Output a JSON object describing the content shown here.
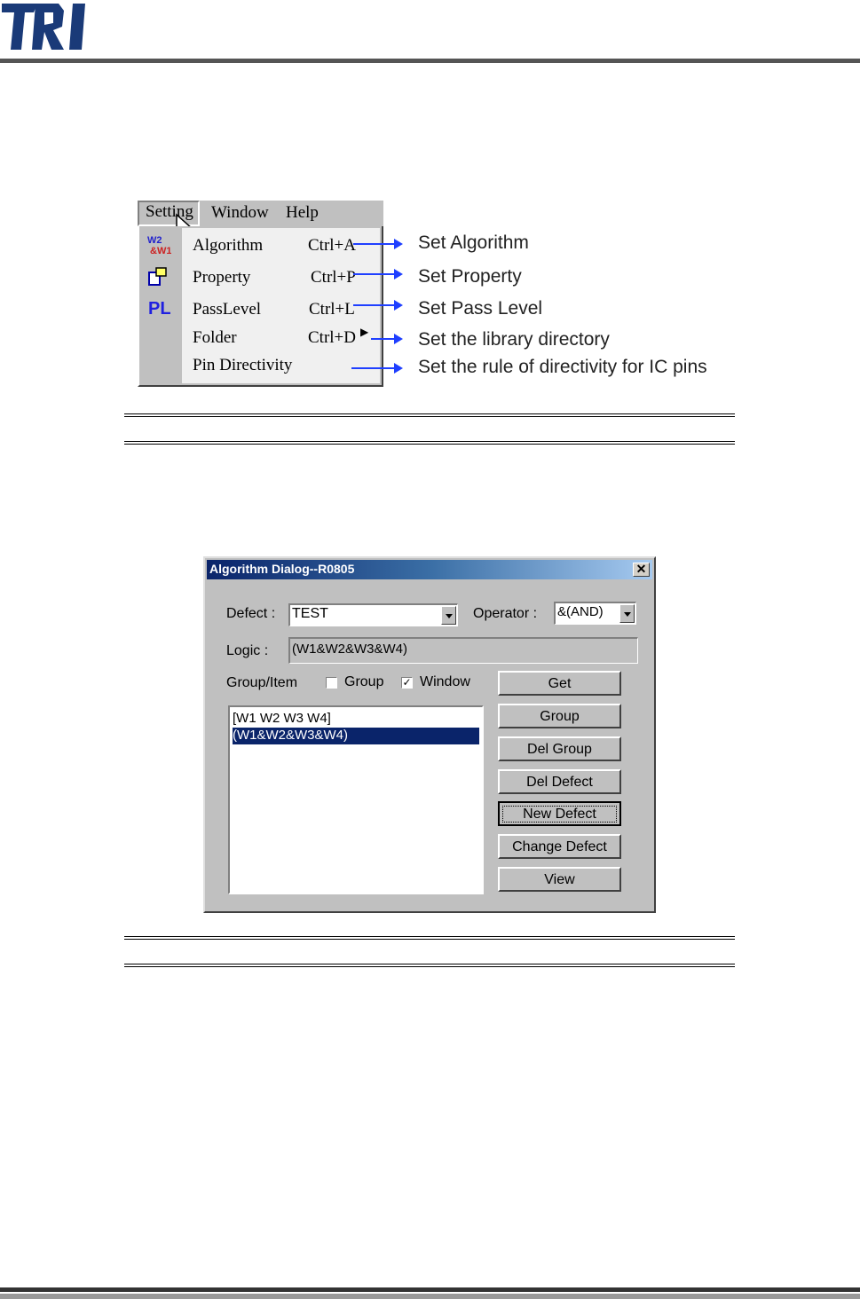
{
  "brand": {
    "logo_text": "TRI",
    "color": "#1a3a78"
  },
  "menu": {
    "bar": [
      {
        "label": "Setting",
        "name": "menu-setting"
      },
      {
        "label": "Window",
        "name": "menu-window"
      },
      {
        "label": "Help",
        "name": "menu-help"
      }
    ],
    "items": [
      {
        "label": "Algorithm",
        "shortcut": "Ctrl+A",
        "icon": "algorithm-icon",
        "annotation": "Set Algorithm"
      },
      {
        "label": "Property",
        "shortcut": "Ctrl+P",
        "icon": "property-icon",
        "annotation": "Set Property"
      },
      {
        "label": "PassLevel",
        "shortcut": "Ctrl+L",
        "icon_text": "PL",
        "annotation": "Set Pass Level"
      },
      {
        "label": "Folder",
        "shortcut": "Ctrl+D",
        "annotation": "Set the library directory"
      },
      {
        "label": "Pin Directivity",
        "shortcut": "",
        "annotation": "Set the rule of directivity for IC pins"
      }
    ]
  },
  "dialog": {
    "title": "Algorithm Dialog--R0805",
    "close_label": "✕",
    "defect_label": "Defect :",
    "defect_value": "TEST",
    "operator_label": "Operator :",
    "operator_value": "&(AND)",
    "logic_label": "Logic :",
    "logic_value": "(W1&W2&W3&W4)",
    "group_item_label": "Group/Item",
    "group_checkbox": {
      "label": "Group",
      "checked": false
    },
    "window_checkbox": {
      "label": "Window",
      "checked": true,
      "mark": "✓"
    },
    "list_items": [
      {
        "text": "[W1 W2 W3 W4]",
        "selected": false
      },
      {
        "text": "(W1&W2&W3&W4)",
        "selected": true
      }
    ],
    "buttons": [
      "Get",
      "Group",
      "Del Group",
      "Del Defect",
      "New Defect",
      "Change Defect",
      "View"
    ],
    "default_button": "New Defect"
  }
}
